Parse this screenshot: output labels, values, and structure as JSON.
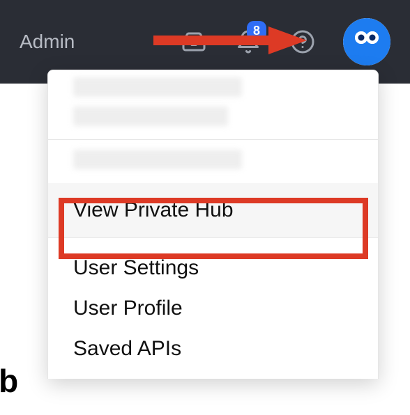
{
  "topbar": {
    "admin_label": "Admin",
    "notification_count": "8"
  },
  "dropdown": {
    "view_private_hub": "View Private Hub",
    "user_settings": "User Settings",
    "user_profile": "User Profile",
    "saved_apis": "Saved APIs"
  },
  "partial_heading": "ub",
  "annotation": {
    "arrow_color": "#dd3a25",
    "highlight_color": "#dd3a25"
  }
}
